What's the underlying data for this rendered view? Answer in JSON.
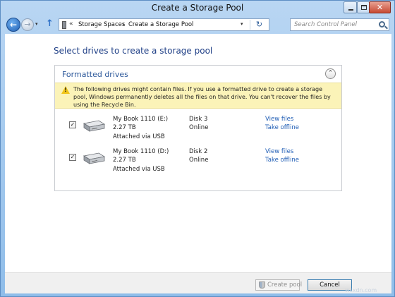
{
  "window": {
    "title": "Create a Storage Pool",
    "minimize_icon": "minimize-icon",
    "maximize_icon": "maximize-icon",
    "close_icon": "close-icon",
    "close_glyph": "✕"
  },
  "nav": {
    "back_glyph": "←",
    "forward_glyph": "→",
    "recent_glyph": "▾",
    "up_glyph": "↑",
    "breadcrumb_prefix": "«",
    "breadcrumb": [
      "Storage Spaces",
      "Create a Storage Pool"
    ],
    "breadcrumb_separator": "›",
    "dropdown_glyph": "▾",
    "refresh_glyph": "↻",
    "search_placeholder": "Search Control Panel"
  },
  "main": {
    "page_title": "Select drives to create a storage pool",
    "group": {
      "title": "Formatted drives",
      "collapse_glyph": "⌃",
      "warning": {
        "icon": "warning-icon",
        "mark": "!",
        "text": "The following drives might contain files. If you use a formatted drive to create a storage pool, Windows permanently deletes all the files on that drive. You can't recover the files by using the Recycle Bin."
      },
      "drives": [
        {
          "checked": true,
          "check_glyph": "✓",
          "icon": "hard-drive-icon",
          "name": "My Book 1110 (E:)",
          "size": "2.27 TB",
          "connection": "Attached via USB",
          "disk": "Disk 3",
          "status": "Online",
          "link1": "View files",
          "link2": "Take offline"
        },
        {
          "checked": true,
          "check_glyph": "✓",
          "icon": "hard-drive-icon",
          "name": "My Book 1110 (D:)",
          "size": "2.27 TB",
          "connection": "Attached via USB",
          "disk": "Disk 2",
          "status": "Online",
          "link1": "View files",
          "link2": "Take offline"
        }
      ]
    }
  },
  "footer": {
    "create_label": "Create pool",
    "create_icon": "shield-icon",
    "cancel_label": "Cancel"
  },
  "watermark": "wsxdn.com"
}
